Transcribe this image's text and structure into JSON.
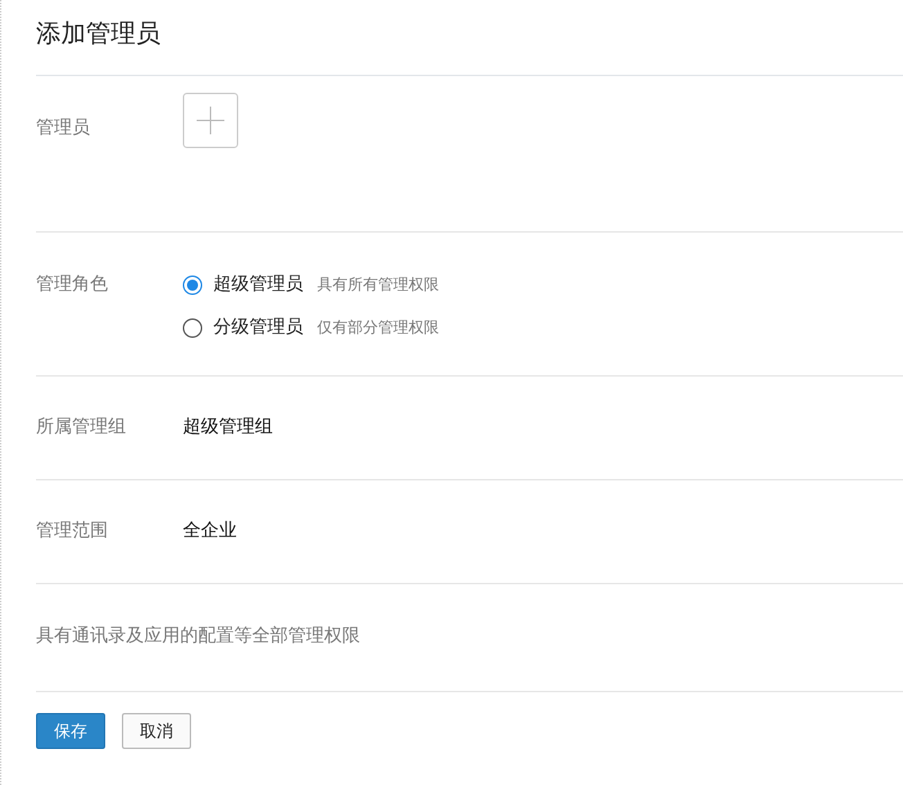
{
  "title": "添加管理员",
  "admin": {
    "label": "管理员"
  },
  "role": {
    "label": "管理角色",
    "options": [
      {
        "name": "超级管理员",
        "hint": "具有所有管理权限",
        "selected": true
      },
      {
        "name": "分级管理员",
        "hint": "仅有部分管理权限",
        "selected": false
      }
    ]
  },
  "fields": [
    {
      "label": "所属管理组",
      "value": "超级管理组"
    },
    {
      "label": "管理范围",
      "value": "全企业"
    }
  ],
  "description": "具有通讯录及应用的配置等全部管理权限",
  "buttons": [
    {
      "label": "保存",
      "kind": "primary"
    },
    {
      "label": "取消",
      "kind": "secondary"
    }
  ]
}
